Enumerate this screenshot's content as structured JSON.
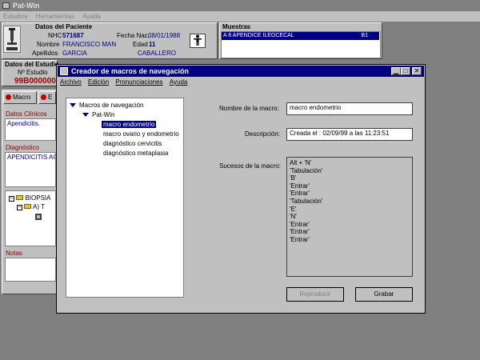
{
  "main_window": {
    "title": "Pat-Win",
    "menu": [
      "Estudios",
      "Herramientas",
      "Ayuda"
    ]
  },
  "patient": {
    "section_title": "Datos del Paciente",
    "nhc_label": "NHC",
    "nhc_value": "571687",
    "fecha_nac_label": "Fecha Nac.",
    "fecha_nac_value": "08/01/1988",
    "nombre_label": "Nombre",
    "nombre_value": "FRANCISCO MAN",
    "edad_label": "Edad",
    "edad_value": "11",
    "apellidos_label": "Apellidos",
    "apellido1_value": "GARCIA",
    "apellido2_value": "CABALLERO"
  },
  "muestras": {
    "section_title": "Muestras",
    "row_text": "A 8 APENDICE ILEOCECAL",
    "row_code": "B1"
  },
  "estudio": {
    "section_title": "Datos del Estudio",
    "nro_label": "Nº Estudio",
    "nro_value": "99B000000"
  },
  "left_panel": {
    "tab_macro": "Macro",
    "tab_other": "E",
    "datos_clinicos_label": "Datos Clínicos",
    "datos_clinicos_value": "Apendicitis.",
    "diagnostico_label": "Diagnóstico",
    "diagnostico_value": "APENDICITIS AG",
    "tree_root": "BIOPSIA",
    "tree_child": "A) T",
    "notas_label": "Notas"
  },
  "dialog": {
    "title": "Creador de macros de navegación",
    "menu": [
      "Archivo",
      "Edición",
      "Pronunciaciones",
      "Ayuda"
    ],
    "tree": {
      "root": "Macros de navegación",
      "group": "Pat-Win",
      "items": [
        "macro endometrio",
        "macro ovario y endometrio",
        "diagnóstico cervicitis",
        "diagnóstico metaplasia"
      ],
      "selected_index": 0
    },
    "nombre_label": "Nombre de la macro:",
    "nombre_value": "macro endometrio",
    "descripcion_label": "Descripción:",
    "descripcion_value": "Creada el : 02/09/99 a las 11:23:51",
    "sucesos_label": "Sucesos de la macro:",
    "sucesos": [
      "Alt + 'N'",
      "'Tabulación'",
      "'B'",
      "'Entrar'",
      "'Entrar'",
      "'Tabulación'",
      "'E'",
      "'N'",
      "'Entrar'",
      "'Entrar'",
      "'Entrar'"
    ],
    "reproducir_label": "Reproducir",
    "grabar_label": "Grabar"
  }
}
